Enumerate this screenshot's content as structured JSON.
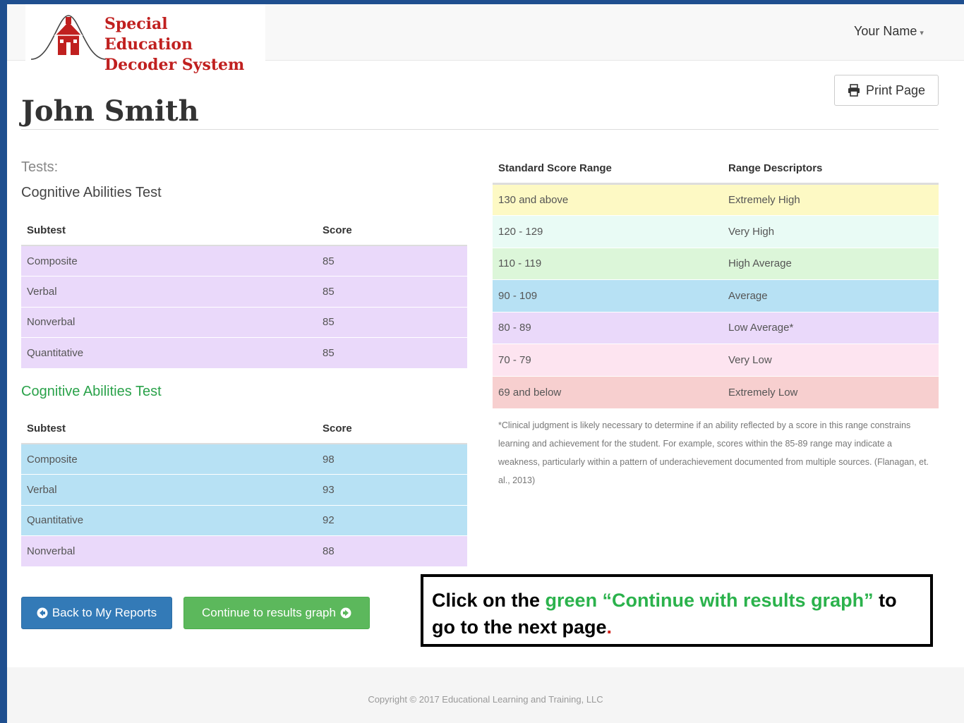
{
  "brand": {
    "line1": "Special Education",
    "line2": "Decoder System"
  },
  "user_menu": {
    "label": "Your Name"
  },
  "print_button": {
    "label": "Print Page"
  },
  "page_title": "John Smith",
  "tests_label": "Tests:",
  "test1": {
    "heading": "Cognitive Abilities Test",
    "columns": [
      "Subtest",
      "Score"
    ],
    "rows": [
      {
        "subtest": "Composite",
        "score": "85"
      },
      {
        "subtest": "Verbal",
        "score": "85"
      },
      {
        "subtest": "Nonverbal",
        "score": "85"
      },
      {
        "subtest": "Quantitative",
        "score": "85"
      }
    ]
  },
  "test2": {
    "heading": "Cognitive Abilities Test",
    "columns": [
      "Subtest",
      "Score"
    ],
    "rows": [
      {
        "subtest": "Composite",
        "score": "98"
      },
      {
        "subtest": "Verbal",
        "score": "93"
      },
      {
        "subtest": "Quantitative",
        "score": "92"
      },
      {
        "subtest": "Nonverbal",
        "score": "88"
      }
    ]
  },
  "range_table": {
    "columns": [
      "Standard Score Range",
      "Range Descriptors"
    ],
    "rows": [
      {
        "range": "130 and above",
        "descriptor": "Extremely High",
        "color": "#fdf9c4"
      },
      {
        "range": "120 - 129",
        "descriptor": "Very High",
        "color": "#e9fbf5"
      },
      {
        "range": "110 - 119",
        "descriptor": "High Average",
        "color": "#dcf6d9"
      },
      {
        "range": "90 - 109",
        "descriptor": "Average",
        "color": "#b7e1f4"
      },
      {
        "range": "80 - 89",
        "descriptor": "Low Average*",
        "color": "#ead9fa"
      },
      {
        "range": "70 - 79",
        "descriptor": "Very Low",
        "color": "#fde4f0"
      },
      {
        "range": "69 and below",
        "descriptor": "Extremely Low",
        "color": "#f7cfcf"
      }
    ]
  },
  "footnote": "*Clinical judgment is likely necessary to determine if an ability reflected by a score in this range constrains learning and achievement for the student. For example, scores within the 85-89 range may indicate a weakness, particularly within a pattern of underachievement documented from multiple sources. (Flanagan, et. al., 2013)",
  "buttons": {
    "back": "Back to My Reports",
    "continue": "Continue to results graph"
  },
  "callout": {
    "part1": "Click on the ",
    "part2": "green “Continue with results graph”",
    "part3": " to go to the next page",
    "part4": "."
  },
  "footer": {
    "copyright": "Copyright © 2017 Educational Learning and Training, LLC"
  },
  "colors": {
    "purple_row": "#ead9fa",
    "blue_row": "#b7e1f4",
    "brand_red": "#c0201f",
    "button_blue": "#337ab7",
    "button_green": "#5cb85c"
  }
}
